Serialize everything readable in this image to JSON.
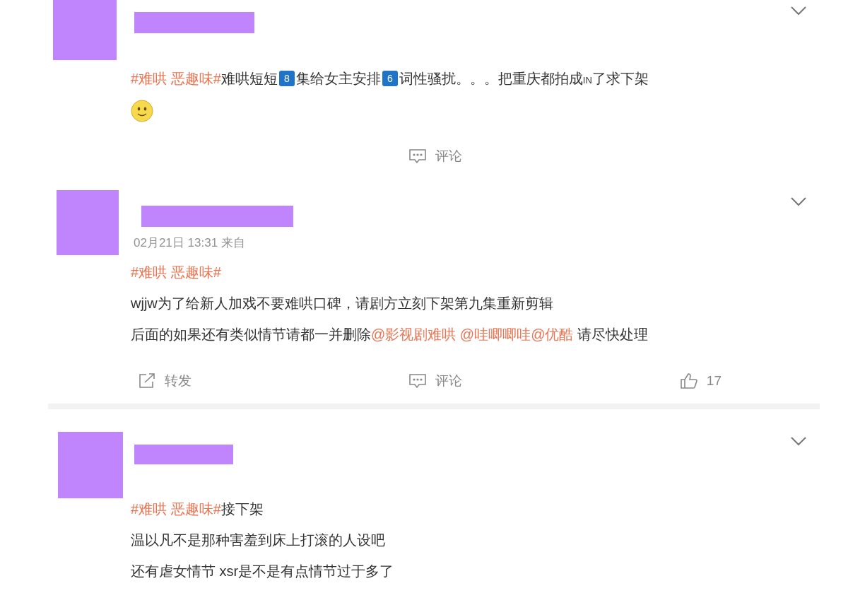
{
  "posts": [
    {
      "lines": [
        [
          {
            "kind": "topic",
            "text": "#难哄 恶趣味#"
          },
          {
            "kind": "text",
            "text": "难哄短短"
          },
          {
            "kind": "keycap",
            "text": "8"
          },
          {
            "kind": "text",
            "text": "集给女主安排"
          },
          {
            "kind": "keycap",
            "text": "6"
          },
          {
            "kind": "text",
            "text": "词性骚扰。。。把重庆都拍成"
          },
          {
            "kind": "small",
            "text": "IN"
          },
          {
            "kind": "text",
            "text": "了求下架"
          }
        ],
        [
          {
            "kind": "emoji"
          }
        ]
      ],
      "actions": [
        {
          "kind": "comment",
          "label": "评论"
        }
      ]
    },
    {
      "time": "02月21日 13:31  来自",
      "lines": [
        [
          {
            "kind": "topic",
            "text": "#难哄 恶趣味#"
          }
        ],
        [
          {
            "kind": "text",
            "text": "wjjw为了给新人加戏不要难哄口碑，请剧方立刻下架第九集重新剪辑"
          }
        ],
        [
          {
            "kind": "text",
            "text": "后面的如果还有类似情节请都一并删除"
          },
          {
            "kind": "mention",
            "text": "@影视剧难哄 "
          },
          {
            "kind": "mention",
            "text": "@哇唧唧哇"
          },
          {
            "kind": "mention",
            "text": "@优酷"
          },
          {
            "kind": "text",
            "text": " 请尽快处理"
          }
        ]
      ],
      "actions": [
        {
          "kind": "repost",
          "label": "转发"
        },
        {
          "kind": "comment",
          "label": "评论"
        },
        {
          "kind": "like",
          "label": "17"
        }
      ]
    },
    {
      "lines": [
        [
          {
            "kind": "topic",
            "text": "#难哄 恶趣味#"
          },
          {
            "kind": "text",
            "text": "接下架"
          }
        ],
        [
          {
            "kind": "text",
            "text": "温以凡不是那种害羞到床上打滚的人设吧"
          }
        ],
        [
          {
            "kind": "text",
            "text": "还有虐女情节 xsr是不是有点情节过于多了"
          }
        ]
      ]
    }
  ]
}
